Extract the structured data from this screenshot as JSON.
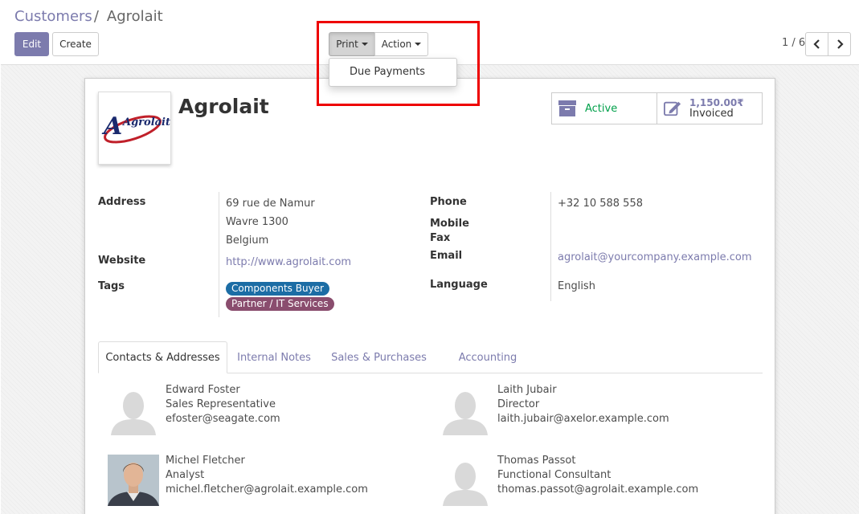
{
  "breadcrumb": {
    "parent": "Customers",
    "separator": "/",
    "current": "Agrolait"
  },
  "buttons": {
    "edit": "Edit",
    "create": "Create",
    "print": "Print",
    "action": "Action"
  },
  "print_menu": {
    "items": [
      "Due Payments"
    ]
  },
  "pager": {
    "value": "1 / 6"
  },
  "record": {
    "name": "Agrolait",
    "logo_text": "Agrolait",
    "stats": {
      "active_label": "Active",
      "invoiced_value": "1,150.00₹",
      "invoiced_label": "Invoiced"
    }
  },
  "fields": {
    "address_label": "Address",
    "address_lines": [
      "69 rue de Namur",
      "Wavre 1300",
      "Belgium"
    ],
    "website_label": "Website",
    "website": "http://www.agrolait.com",
    "tags_label": "Tags",
    "tags": [
      "Components Buyer",
      "Partner / IT Services"
    ],
    "phone_label": "Phone",
    "phone": "+32 10 588 558",
    "mobile_label": "Mobile",
    "fax_label": "Fax",
    "email_label": "Email",
    "email": "agrolait@yourcompany.example.com",
    "language_label": "Language",
    "language": "English"
  },
  "tabs": [
    "Contacts & Addresses",
    "Internal Notes",
    "Sales & Purchases",
    "Accounting"
  ],
  "contacts": [
    {
      "name": "Edward Foster",
      "role": "Sales Representative",
      "email": "efoster@seagate.com"
    },
    {
      "name": "Laith Jubair",
      "role": "Director",
      "email": "laith.jubair@axelor.example.com"
    },
    {
      "name": "Michel Fletcher",
      "role": "Analyst",
      "email": "michel.fletcher@agrolait.example.com"
    },
    {
      "name": "Thomas Passot",
      "role": "Functional Consultant",
      "email": "thomas.passot@agrolait.example.com"
    }
  ],
  "colors": {
    "brand": "#7c7bad",
    "active": "#00a04a",
    "tag_blue": "#1c6da5",
    "tag_purple": "#8a4d6e",
    "highlight": "#ee0000"
  }
}
